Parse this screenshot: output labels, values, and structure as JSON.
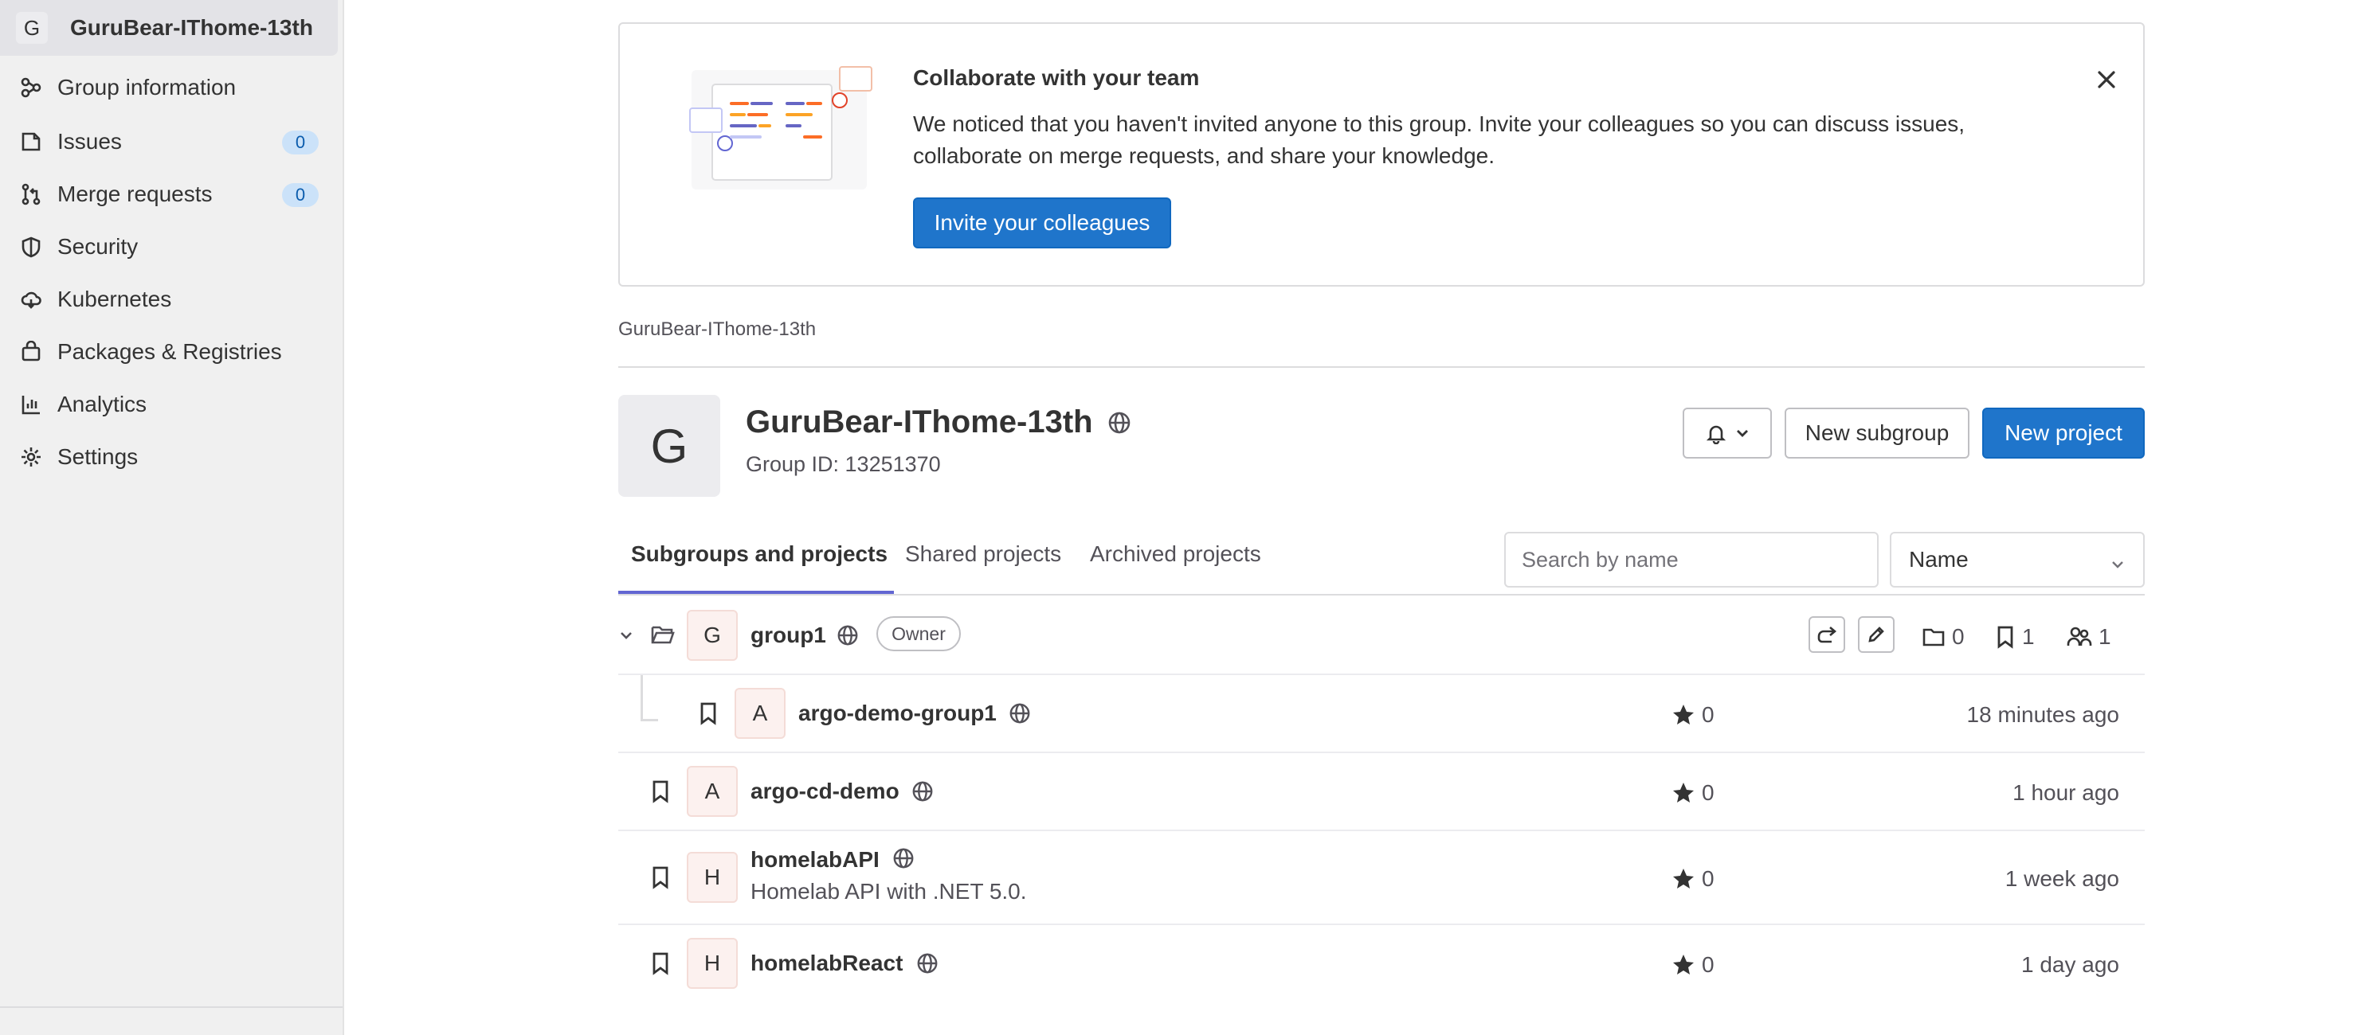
{
  "sidebar": {
    "group_initial": "G",
    "group_name": "GuruBear-IThome-13th",
    "items": [
      {
        "label": "Group information",
        "icon": "group-icon"
      },
      {
        "label": "Issues",
        "icon": "issues-icon",
        "count": "0"
      },
      {
        "label": "Merge requests",
        "icon": "merge-request-icon",
        "count": "0"
      },
      {
        "label": "Security",
        "icon": "shield-icon"
      },
      {
        "label": "Kubernetes",
        "icon": "cloud-icon"
      },
      {
        "label": "Packages & Registries",
        "icon": "package-icon"
      },
      {
        "label": "Analytics",
        "icon": "chart-icon"
      },
      {
        "label": "Settings",
        "icon": "gear-icon"
      }
    ]
  },
  "invite_alert": {
    "title": "Collaborate with your team",
    "body": "We noticed that you haven't invited anyone to this group. Invite your colleagues so you can discuss issues, collaborate on merge requests, and share your knowledge.",
    "cta": "Invite your colleagues"
  },
  "breadcrumb": "GuruBear-IThome-13th",
  "group": {
    "initial": "G",
    "name": "GuruBear-IThome-13th",
    "id_text": "Group ID: 13251370"
  },
  "actions": {
    "new_subgroup": "New subgroup",
    "new_project": "New project"
  },
  "tabs": {
    "subgroups": "Subgroups and projects",
    "shared": "Shared projects",
    "archived": "Archived projects"
  },
  "search": {
    "placeholder": "Search by name"
  },
  "sort": {
    "selected": "Name"
  },
  "subgroup": {
    "initial": "G",
    "name": "group1",
    "role": "Owner",
    "subgroups_count": "0",
    "projects_count": "1",
    "members_count": "1"
  },
  "projects": [
    {
      "initial": "A",
      "name": "argo-demo-group1",
      "stars": "0",
      "updated": "18 minutes ago",
      "desc": ""
    },
    {
      "initial": "A",
      "name": "argo-cd-demo",
      "stars": "0",
      "updated": "1 hour ago",
      "desc": ""
    },
    {
      "initial": "H",
      "name": "homelabAPI",
      "stars": "0",
      "updated": "1 week ago",
      "desc": "Homelab API with .NET 5.0."
    },
    {
      "initial": "H",
      "name": "homelabReact",
      "stars": "0",
      "updated": "1 day ago",
      "desc": ""
    }
  ],
  "colors": {
    "primary": "#1f75cb",
    "tab_active": "#6266d2",
    "badge_bg": "#cbe2f9",
    "avatar_bg": "#fcf1ef"
  }
}
